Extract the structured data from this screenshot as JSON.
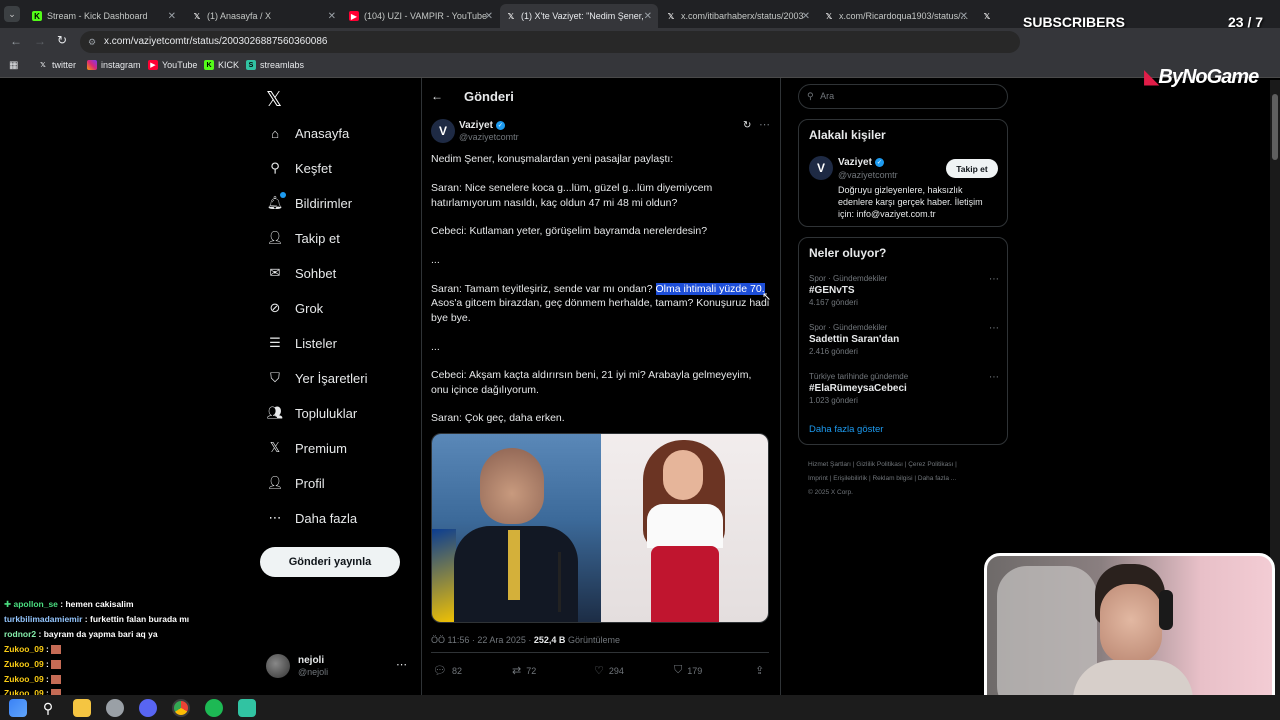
{
  "browser": {
    "tabs": [
      {
        "label": "Stream - Kick Dashboard",
        "icon": "kick-icon"
      },
      {
        "label": "(1) Anasayfa / X",
        "icon": "x-icon"
      },
      {
        "label": "(104) UZI - VAMPIR - YouTube",
        "icon": "youtube-icon"
      },
      {
        "label": "(1) X'te Vaziyet: \"Nedim Şener,",
        "icon": "x-icon"
      },
      {
        "label": "x.com/itibarhaberx/status/2003",
        "icon": "x-icon"
      },
      {
        "label": "x.com/Ricardoqua1903/status/...",
        "icon": "x-icon"
      },
      {
        "label": "X",
        "icon": "x-icon"
      }
    ],
    "url": "x.com/vaziyetcomtr/status/2003026887560360086",
    "bookmarks": [
      "twitter",
      "instagram",
      "YouTube",
      "KICK",
      "streamlabs"
    ]
  },
  "overlay": {
    "subscribers_label": "SUBSCRIBERS",
    "subscribers_count": "23 / 7",
    "subscribers_progress": 0.05,
    "brand": "ByNoGame"
  },
  "sidebar": {
    "nav": [
      {
        "label": "Anasayfa",
        "icon": "home-icon"
      },
      {
        "label": "Keşfet",
        "icon": "search-icon"
      },
      {
        "label": "Bildirimler",
        "icon": "bell-icon"
      },
      {
        "label": "Takip et",
        "icon": "follow-icon"
      },
      {
        "label": "Sohbet",
        "icon": "mail-icon"
      },
      {
        "label": "Grok",
        "icon": "grok-icon"
      },
      {
        "label": "Listeler",
        "icon": "list-icon"
      },
      {
        "label": "Yer İşaretleri",
        "icon": "bookmark-icon"
      },
      {
        "label": "Topluluklar",
        "icon": "communities-icon"
      },
      {
        "label": "Premium",
        "icon": "x-icon"
      },
      {
        "label": "Profil",
        "icon": "profile-icon"
      },
      {
        "label": "Daha fazla",
        "icon": "more-icon"
      }
    ],
    "post_button": "Gönderi yayınla",
    "account": {
      "name": "nejoli",
      "handle": "@nejoli"
    }
  },
  "post": {
    "header_title": "Gönderi",
    "author": {
      "name": "Vaziyet",
      "handle": "@vaziyetcomtr"
    },
    "lines": [
      "Nedim Şener, konuşmalardan yeni pasajlar paylaştı:",
      "Saran: Nice senelere koca g...lüm, güzel g...lüm diyemiycem hatırlamıyorum nasıldı, kaç oldun 47 mi 48 mi oldun?",
      "Cebeci: Kutlaman yeter, görüşelim bayramda nerelerdesin?",
      "...",
      "Asos'a gitcem birazdan, geç dönmem herhalde, tamam? Konuşuruz hadi bye bye.",
      "...",
      "Cebeci: Akşam kaçta aldırırsın beni, 21 iyi mi? Arabayla gelmeyeyim, onu içince dağılıyorum.",
      "Saran: Çok geç, daha erken."
    ],
    "saran_line_start": "Saran: Tamam teyitleşiriz, sende var mı ondan? ",
    "saran_line_highlight": "Olma ihtimali yüzde 70.",
    "meta_time": "ÖÖ 11:56 · 22 Ara 2025 · ",
    "meta_views": "252,4 B",
    "meta_views_label": " Görüntüleme",
    "actions": {
      "replies": "82",
      "reposts": "72",
      "likes": "294",
      "bookmarks": "179"
    }
  },
  "right": {
    "search_placeholder": "Ara",
    "related_title": "Alakalı kişiler",
    "related": {
      "name": "Vaziyet",
      "handle": "@vaziyetcomtr",
      "bio": "Doğruyu gizleyenlere, haksızlık edenlere karşı gerçek haber. İletişim için: info@vaziyet.com.tr",
      "follow": "Takip et"
    },
    "trends_title": "Neler oluyor?",
    "trends": [
      {
        "category": "Spor · Gündemdekiler",
        "name": "#GENvTS",
        "count": "4.167 gönderi"
      },
      {
        "category": "Spor · Gündemdekiler",
        "name": "Sadettin Saran'dan",
        "count": "2.416 gönderi"
      },
      {
        "category": "Türkiye tarihinde gündemde",
        "name": "#ElaRümeysaCebeci",
        "count": "1.023 gönderi"
      }
    ],
    "show_more": "Daha fazla göster",
    "footer": [
      "Hizmet Şartları",
      "Gizlilik Politikası",
      "Çerez Politikası",
      "Imprint",
      "Erişilebilirlik",
      "Reklam bilgisi",
      "Daha fazla ...",
      "© 2025 X Corp."
    ]
  },
  "chat": [
    {
      "user": "apollon_se",
      "text": "hemen cakisalim",
      "color": "#4ade80"
    },
    {
      "user": "turkbilimadamiemir",
      "text": "furkettin falan burada mı",
      "color": "#93c5fd"
    },
    {
      "user": "rodnor2",
      "text": "bayram da yapma bari aq ya",
      "color": "#86efac"
    },
    {
      "user": "Zukoo_09",
      "text": "",
      "color": "#facc15"
    },
    {
      "user": "Zukoo_09",
      "text": "",
      "color": "#facc15"
    },
    {
      "user": "Zukoo_09",
      "text": "",
      "color": "#facc15"
    },
    {
      "user": "Zukoo_09",
      "text": "",
      "color": "#facc15"
    }
  ],
  "colors": {
    "accent": "#1d9bf0",
    "background": "#000000",
    "border": "#2f3336"
  }
}
